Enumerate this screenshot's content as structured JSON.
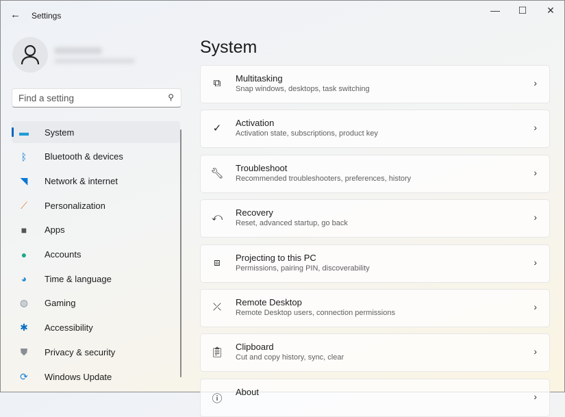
{
  "window": {
    "title": "Settings"
  },
  "search": {
    "placeholder": "Find a setting"
  },
  "nav": [
    {
      "label": "System",
      "icon": "monitor-icon",
      "color": "#1e9bd7"
    },
    {
      "label": "Bluetooth & devices",
      "icon": "bluetooth-icon",
      "color": "#0a78d4"
    },
    {
      "label": "Network & internet",
      "icon": "wifi-icon",
      "color": "#0a78d4"
    },
    {
      "label": "Personalization",
      "icon": "brush-icon",
      "color": "#e07a3a"
    },
    {
      "label": "Apps",
      "icon": "apps-icon",
      "color": "#555"
    },
    {
      "label": "Accounts",
      "icon": "person-icon",
      "color": "#1fa88a"
    },
    {
      "label": "Time & language",
      "icon": "clock-globe-icon",
      "color": "#2a8fd0"
    },
    {
      "label": "Gaming",
      "icon": "gamepad-icon",
      "color": "#8a93a0"
    },
    {
      "label": "Accessibility",
      "icon": "accessibility-icon",
      "color": "#0a6fc4"
    },
    {
      "label": "Privacy & security",
      "icon": "shield-icon",
      "color": "#8a8f96"
    },
    {
      "label": "Windows Update",
      "icon": "update-icon",
      "color": "#1583d8"
    }
  ],
  "page": {
    "title": "System"
  },
  "cards": [
    {
      "title": "Multitasking",
      "subtitle": "Snap windows, desktops, task switching",
      "icon": "multitasking-icon"
    },
    {
      "title": "Activation",
      "subtitle": "Activation state, subscriptions, product key",
      "icon": "check-circle-icon"
    },
    {
      "title": "Troubleshoot",
      "subtitle": "Recommended troubleshooters, preferences, history",
      "icon": "wrench-icon"
    },
    {
      "title": "Recovery",
      "subtitle": "Reset, advanced startup, go back",
      "icon": "recovery-icon"
    },
    {
      "title": "Projecting to this PC",
      "subtitle": "Permissions, pairing PIN, discoverability",
      "icon": "projecting-icon"
    },
    {
      "title": "Remote Desktop",
      "subtitle": "Remote Desktop users, connection permissions",
      "icon": "remote-desktop-icon"
    },
    {
      "title": "Clipboard",
      "subtitle": "Cut and copy history, sync, clear",
      "icon": "clipboard-icon"
    },
    {
      "title": "About",
      "subtitle": "",
      "icon": "info-icon"
    }
  ]
}
